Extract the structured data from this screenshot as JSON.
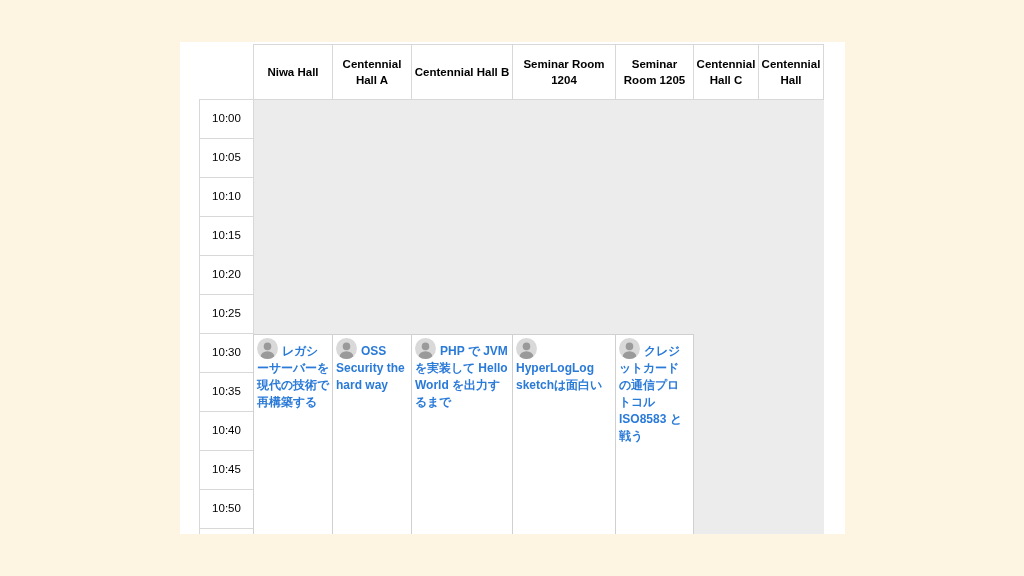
{
  "rooms": [
    {
      "name": "Niwa Hall",
      "session": {
        "title": "レガシーサーバーを現代の技術で再構築する"
      }
    },
    {
      "name": "Centennial Hall A",
      "session": {
        "title": "OSS Security the hard way"
      }
    },
    {
      "name": "Centennial Hall B",
      "session": {
        "title": "PHP で JVM を実装して Hello World を出力するまで"
      }
    },
    {
      "name": "Seminar Room 1204",
      "session": {
        "title": "HyperLogLog sketchは面白い"
      }
    },
    {
      "name": "Seminar Room 1205",
      "session": {
        "title": "クレジットカードの通信プロトコル ISO8583 と戦う"
      }
    },
    {
      "name": "Centennial Hall C"
    },
    {
      "name": "Centennial Hall"
    }
  ],
  "times": [
    "10:00",
    "10:05",
    "10:10",
    "10:15",
    "10:20",
    "10:25",
    "10:30",
    "10:35",
    "10:40",
    "10:45",
    "10:50"
  ]
}
